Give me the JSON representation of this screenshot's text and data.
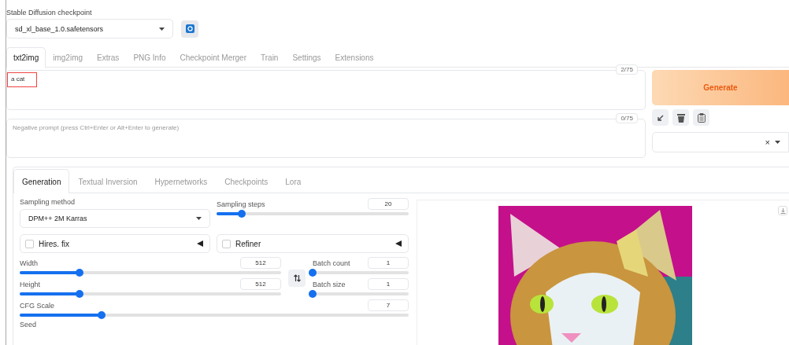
{
  "checkpoint": {
    "label": "Stable Diffusion checkpoint",
    "value": "sd_xl_base_1.0.safetensors"
  },
  "main_tabs": [
    {
      "label": "txt2img",
      "selected": true
    },
    {
      "label": "img2img",
      "selected": false
    },
    {
      "label": "Extras",
      "selected": false
    },
    {
      "label": "PNG Info",
      "selected": false
    },
    {
      "label": "Checkpoint Merger",
      "selected": false
    },
    {
      "label": "Train",
      "selected": false
    },
    {
      "label": "Settings",
      "selected": false
    },
    {
      "label": "Extensions",
      "selected": false
    }
  ],
  "prompt": {
    "value": "a cat",
    "counter": "2/75"
  },
  "negative_prompt": {
    "placeholder": "Negative prompt (press Ctrl+Enter or Alt+Enter to generate)",
    "counter": "0/75"
  },
  "generate_button": "Generate",
  "styles": {
    "clear": "×"
  },
  "sub_tabs": [
    {
      "label": "Generation",
      "selected": true
    },
    {
      "label": "Textual Inversion",
      "selected": false
    },
    {
      "label": "Hypernetworks",
      "selected": false
    },
    {
      "label": "Checkpoints",
      "selected": false
    },
    {
      "label": "Lora",
      "selected": false
    }
  ],
  "sampling_method": {
    "label": "Sampling method",
    "value": "DPM++ 2M Karras"
  },
  "sampling_steps": {
    "label": "Sampling steps",
    "value": "20",
    "level": 0.13
  },
  "hires_fix": {
    "label": "Hires. fix",
    "checked": false
  },
  "refiner": {
    "label": "Refiner",
    "checked": false
  },
  "width": {
    "label": "Width",
    "value": "512",
    "level": 0.23
  },
  "height": {
    "label": "Height",
    "value": "512",
    "level": 0.23
  },
  "batch_count": {
    "label": "Batch count",
    "value": "1",
    "level": 0
  },
  "batch_size": {
    "label": "Batch size",
    "value": "1",
    "level": 0
  },
  "cfg_scale": {
    "label": "CFG Scale",
    "value": "7",
    "level": 0.21
  },
  "seed": {
    "label": "Seed"
  }
}
